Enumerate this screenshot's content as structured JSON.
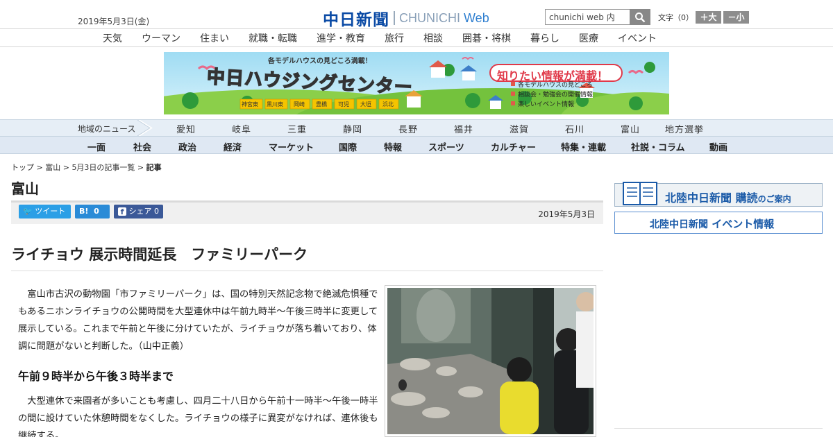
{
  "header": {
    "date": "2019年5月3日(金)",
    "logo_jp": "中日新聞",
    "logo_en": "CHUNICHI",
    "logo_web": "Web",
    "search_value": "chunichi web 内",
    "font_size_label": "文字（0）",
    "font_plus": "＋大",
    "font_minus": "－小"
  },
  "nav_main": [
    "天気",
    "ウーマン",
    "住まい",
    "就職・転職",
    "進学・教育",
    "旅行",
    "相談",
    "囲碁・将棋",
    "暮らし",
    "医療",
    "イベント"
  ],
  "banner": {
    "top_text": "各モデルハウスの見どころ満載！",
    "title": "中日ハウジングセンター",
    "bubble": "知りたい情報が満載！",
    "places": [
      "神宮東",
      "黒川東",
      "岡崎",
      "豊橋",
      "可児",
      "大垣",
      "浜北"
    ],
    "bullets": [
      "各モデルハウスの見どころ",
      "相談会・勉強会の開催情報",
      "楽しいイベント情報"
    ]
  },
  "nav_regions": {
    "label": "地域のニュース",
    "items": [
      "愛知",
      "岐阜",
      "三重",
      "静岡",
      "長野",
      "福井",
      "滋賀",
      "石川",
      "富山",
      "地方選挙"
    ]
  },
  "nav_categories": [
    "一面",
    "社会",
    "政治",
    "経済",
    "マーケット",
    "国際",
    "特報",
    "スポーツ",
    "カルチャー",
    "特集・連載",
    "社説・コラム",
    "動画"
  ],
  "breadcrumb": {
    "top": "トップ",
    "region": "富山",
    "list": "5月3日の記事一覧",
    "current": "記事",
    "sep": " > "
  },
  "page_title": "富山",
  "share": {
    "tweet": "ツイート",
    "hatena": "B!",
    "hatena_count": "0",
    "fb": "シェア",
    "fb_count": "0",
    "date": "2019年5月3日"
  },
  "article": {
    "headline": "ライチョウ 展示時間延長　ファミリーパーク",
    "p1": "　富山市古沢の動物園「市ファミリーパーク」は、国の特別天然記念物で絶滅危惧種でもあるニホンライチョウの公開時間を大型連休中は午前九時半～午後三時半に変更して展示している。これまで午前と午後に分けていたが、ライチョウが落ち着いており、体調に問題がないと判断した。（山中正義）",
    "subhead": "午前９時半から午後３時半まで",
    "p2": "　大型連休で来園者が多いことも考慮し、四月二十八日から午前十一時半～午後一時半の間に設けていた休憩時間をなくした。ライチョウの様子に異変がなければ、連休後も継続する。"
  },
  "sidebar": {
    "banner1_title": "北陸中日新聞",
    "banner1_sub": "購読",
    "banner1_tail": "のご案内",
    "banner2_title": "北陸中日新聞",
    "banner2_tail": "イベント情報"
  },
  "colors": {
    "brand_blue": "#0a4aa5",
    "twitter": "#2b9fe6",
    "hatena": "#2a8bd7",
    "facebook": "#3b5998"
  }
}
